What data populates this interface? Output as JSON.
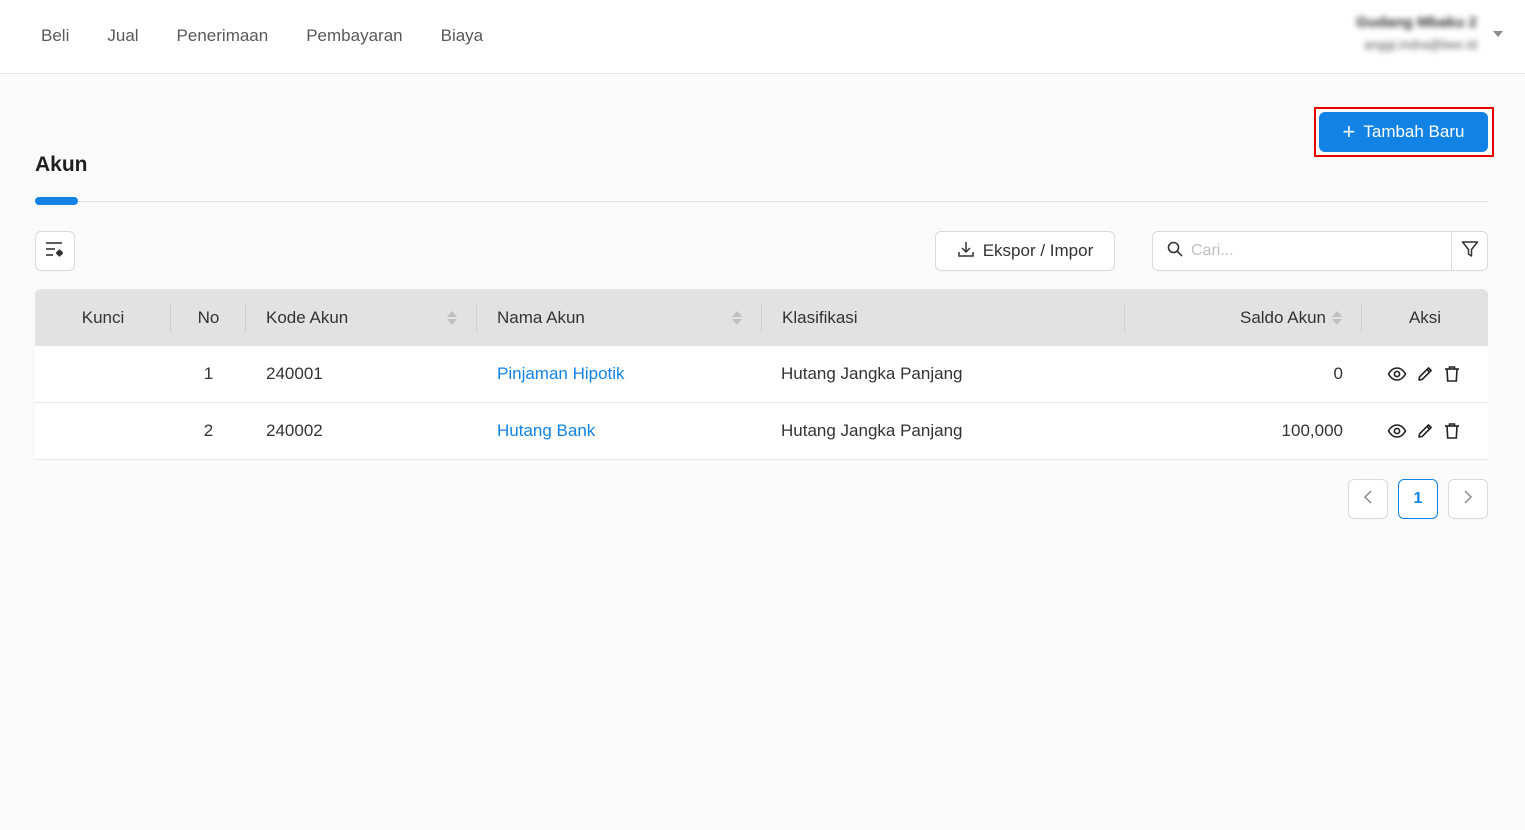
{
  "nav": {
    "items": [
      "Beli",
      "Jual",
      "Penerimaan",
      "Pembayaran",
      "Biaya"
    ]
  },
  "user": {
    "name": "Gudang Mbaku 2",
    "email": "anggi.indra@bee.id"
  },
  "header": {
    "add_button_label": "Tambah Baru",
    "title": "Akun"
  },
  "toolbar": {
    "export_label": "Ekspor / Impor",
    "search_placeholder": "Cari...",
    "search_value": ""
  },
  "table": {
    "columns": {
      "kunci": "Kunci",
      "no": "No",
      "kode": "Kode Akun",
      "nama": "Nama Akun",
      "klasifikasi": "Klasifikasi",
      "saldo": "Saldo Akun",
      "aksi": "Aksi"
    },
    "rows": [
      {
        "no": "1",
        "kode": "240001",
        "nama": "Pinjaman Hipotik",
        "klasifikasi": "Hutang Jangka Panjang",
        "saldo": "0"
      },
      {
        "no": "2",
        "kode": "240002",
        "nama": "Hutang Bank",
        "klasifikasi": "Hutang Jangka Panjang",
        "saldo": "100,000"
      }
    ]
  },
  "pagination": {
    "current_page": "1"
  },
  "colors": {
    "accent": "#1283e5",
    "highlight": "#e00000",
    "header_bg": "#e2e2e2"
  }
}
